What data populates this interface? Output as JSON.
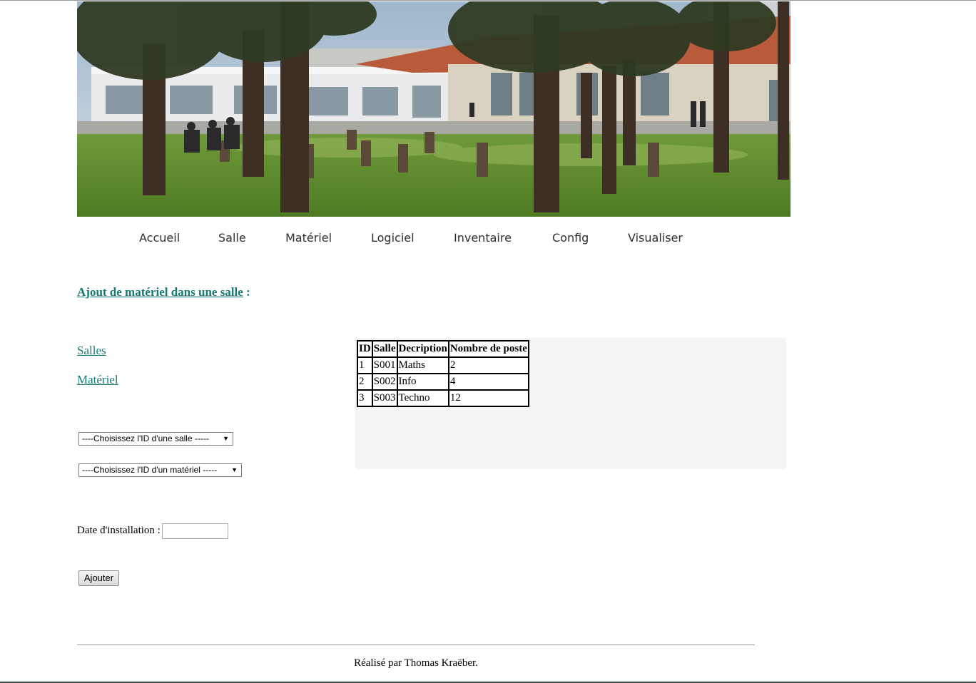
{
  "nav": {
    "items": [
      {
        "label": "Accueil"
      },
      {
        "label": "Salle"
      },
      {
        "label": "Matériel"
      },
      {
        "label": "Logiciel"
      },
      {
        "label": "Inventaire"
      },
      {
        "label": "Config"
      },
      {
        "label": "Visualiser"
      }
    ]
  },
  "main": {
    "heading_link": "Ajout de matériel dans une salle",
    "heading_suffix": " :",
    "side_links": {
      "salles": "Salles",
      "materiel": "Matériel"
    },
    "form": {
      "select_salle": "----Choisissez l'ID d'une salle -----",
      "select_materiel": "----Choisissez l'ID d'un matériel -----",
      "date_label": "Date d'installation :",
      "date_value": "",
      "submit_label": "Ajouter"
    },
    "table": {
      "headers": [
        "ID",
        "Salle",
        "Decription",
        "Nombre de poste"
      ],
      "rows": [
        [
          "1",
          "S001",
          "Maths",
          "2"
        ],
        [
          "2",
          "S002",
          "Info",
          "4"
        ],
        [
          "3",
          "S003",
          "Techno",
          "12"
        ]
      ]
    }
  },
  "footer": {
    "text": "Réalisé par Thomas Kraëber."
  },
  "colors": {
    "link": "#157a72",
    "nav_text": "#2f2f2f",
    "panel_bg": "#f5f5f5"
  },
  "icons": {
    "select_arrow": "dropdown-arrow-icon"
  }
}
